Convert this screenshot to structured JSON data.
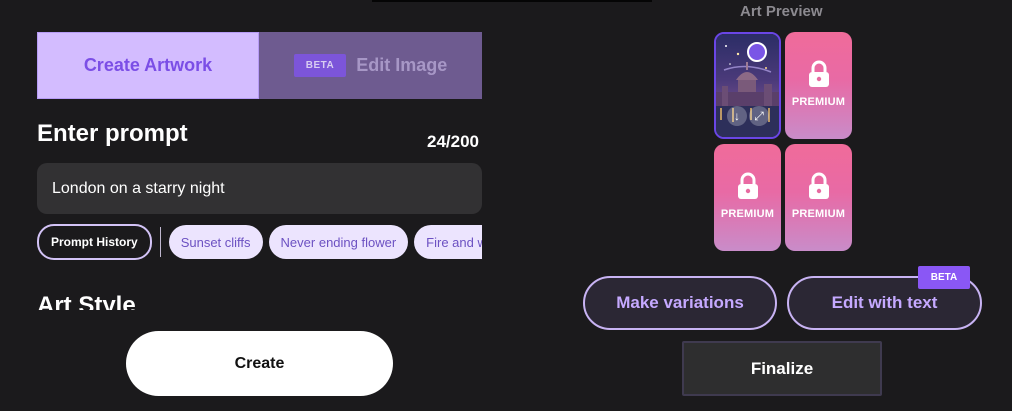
{
  "tabs": {
    "create_label": "Create Artwork",
    "edit_label": "Edit Image",
    "edit_badge": "BETA"
  },
  "prompt": {
    "title": "Enter prompt",
    "counter": "24/200",
    "value": "London on a starry night"
  },
  "chips": {
    "history_label": "Prompt History",
    "suggestions": [
      "Sunset cliffs",
      "Never ending flower",
      "Fire and w"
    ]
  },
  "art_style": {
    "title": "Art Style"
  },
  "create_button": {
    "label": "Create"
  },
  "preview": {
    "title": "Art Preview",
    "premium_label": "PREMIUM",
    "tiles": [
      {
        "type": "image",
        "selected": true
      },
      {
        "type": "premium"
      },
      {
        "type": "premium"
      },
      {
        "type": "premium"
      }
    ]
  },
  "actions": {
    "make_variations": "Make variations",
    "edit_with_text": "Edit with text",
    "edit_with_text_badge": "BETA",
    "finalize": "Finalize"
  },
  "colors": {
    "accent": "#7b4ee6",
    "tab_active_bg": "#d3bcff",
    "premium_pink": "#f06b9a",
    "background": "#1b1a1c"
  }
}
